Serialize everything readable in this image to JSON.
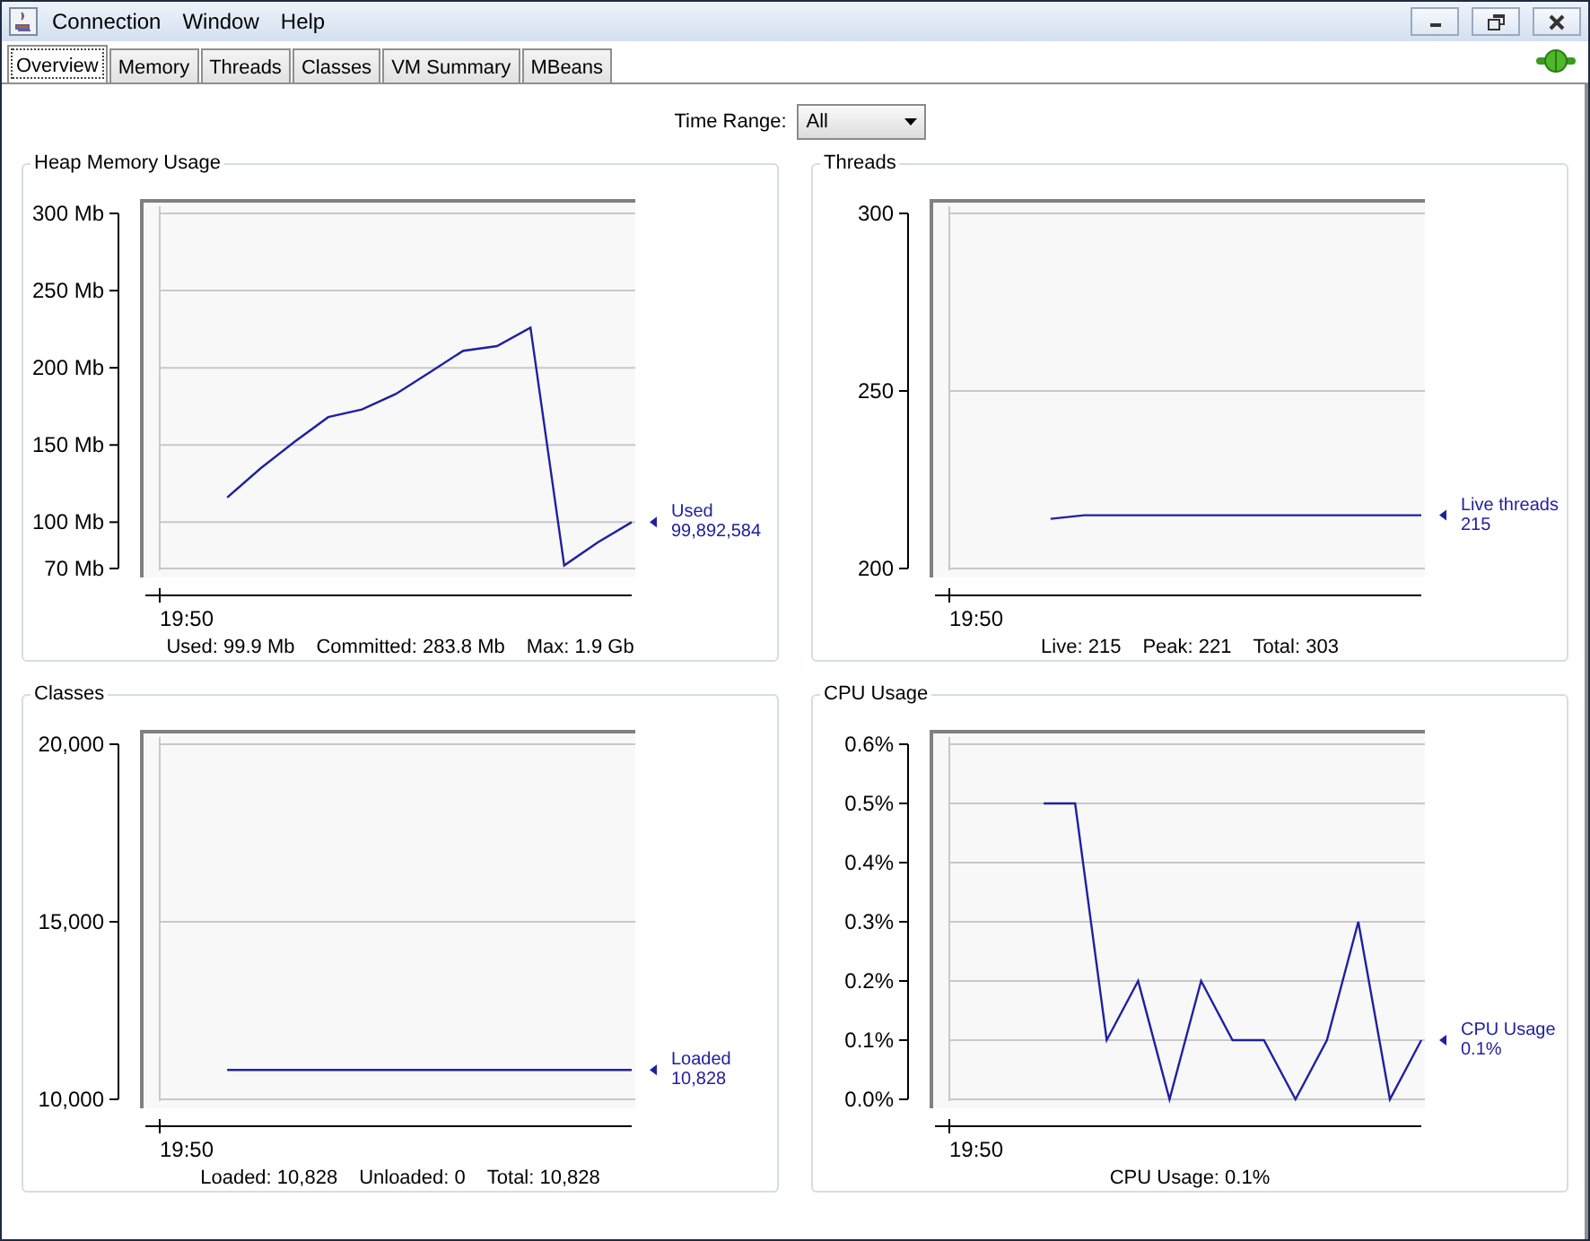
{
  "window": {
    "menu": [
      "Connection",
      "Window",
      "Help"
    ]
  },
  "tabs": [
    {
      "label": "Overview",
      "selected": true
    },
    {
      "label": "Memory",
      "selected": false
    },
    {
      "label": "Threads",
      "selected": false
    },
    {
      "label": "Classes",
      "selected": false
    },
    {
      "label": "VM Summary",
      "selected": false
    },
    {
      "label": "MBeans",
      "selected": false
    }
  ],
  "time_range": {
    "label": "Time Range:",
    "value": "All"
  },
  "panels": [
    {
      "title": "Heap Memory Usage",
      "reading": "99,892,584",
      "stats": [
        "Used: 99.9 Mb",
        "Committed: 283.8 Mb",
        "Max: 1.9 Gb"
      ],
      "time_label": "19:50",
      "chart_data": {
        "type": "line",
        "grid": true,
        "ylim": [
          70,
          300
        ],
        "yticks": [
          {
            "value": 300,
            "label": "300 Mb"
          },
          {
            "value": 250,
            "label": "250 Mb"
          },
          {
            "value": 200,
            "label": "200 Mb"
          },
          {
            "value": 150,
            "label": "150 Mb"
          },
          {
            "value": 100,
            "label": "100 Mb"
          },
          {
            "value": 70,
            "label": "70 Mb"
          }
        ],
        "series": [
          {
            "name": "Used",
            "color": "#2020a0",
            "values": [
              null,
              null,
              116,
              135,
              152,
              168,
              173,
              183,
              197,
              211,
              214,
              226,
              72,
              87,
              100
            ]
          }
        ]
      }
    },
    {
      "title": "Threads",
      "reading": "215",
      "stats": [
        "Live: 215",
        "Peak: 221",
        "Total: 303"
      ],
      "time_label": "19:50",
      "chart_data": {
        "type": "line",
        "grid": true,
        "ylim": [
          200,
          300
        ],
        "yticks": [
          {
            "value": 300,
            "label": "300"
          },
          {
            "value": 250,
            "label": "250"
          },
          {
            "value": 200,
            "label": "200"
          }
        ],
        "series": [
          {
            "name": "Live threads",
            "color": "#2020a0",
            "values": [
              null,
              null,
              null,
              214,
              215,
              215,
              215,
              215,
              215,
              215,
              215,
              215,
              215,
              215,
              215
            ]
          }
        ]
      }
    },
    {
      "title": "Classes",
      "reading": "10,828",
      "stats": [
        "Loaded: 10,828",
        "Unloaded: 0",
        "Total: 10,828"
      ],
      "time_label": "19:50",
      "chart_data": {
        "type": "line",
        "grid": true,
        "ylim": [
          10000,
          20000
        ],
        "yticks": [
          {
            "value": 20000,
            "label": "20,000"
          },
          {
            "value": 15000,
            "label": "15,000"
          },
          {
            "value": 10000,
            "label": "10,000"
          }
        ],
        "series": [
          {
            "name": "Loaded",
            "color": "#2020a0",
            "values": [
              null,
              null,
              10828,
              10828,
              10828,
              10828,
              10828,
              10828,
              10828,
              10828,
              10828,
              10828,
              10828,
              10828,
              10828
            ]
          }
        ]
      }
    },
    {
      "title": "CPU Usage",
      "reading": "0.1%",
      "stats": [
        "CPU Usage: 0.1%"
      ],
      "time_label": "19:50",
      "chart_data": {
        "type": "line",
        "grid": true,
        "ylim": [
          0,
          0.6
        ],
        "yticks": [
          {
            "value": 0.6,
            "label": "0.6%"
          },
          {
            "value": 0.5,
            "label": "0.5%"
          },
          {
            "value": 0.4,
            "label": "0.4%"
          },
          {
            "value": 0.3,
            "label": "0.3%"
          },
          {
            "value": 0.2,
            "label": "0.2%"
          },
          {
            "value": 0.1,
            "label": "0.1%"
          },
          {
            "value": 0,
            "label": "0.0%"
          }
        ],
        "series": [
          {
            "name": "CPU Usage",
            "color": "#2020a0",
            "values": [
              null,
              null,
              null,
              0.5,
              0.5,
              0.1,
              0.2,
              0,
              0.2,
              0.1,
              0.1,
              0,
              0.1,
              0.3,
              0,
              0.1
            ]
          }
        ]
      }
    }
  ]
}
